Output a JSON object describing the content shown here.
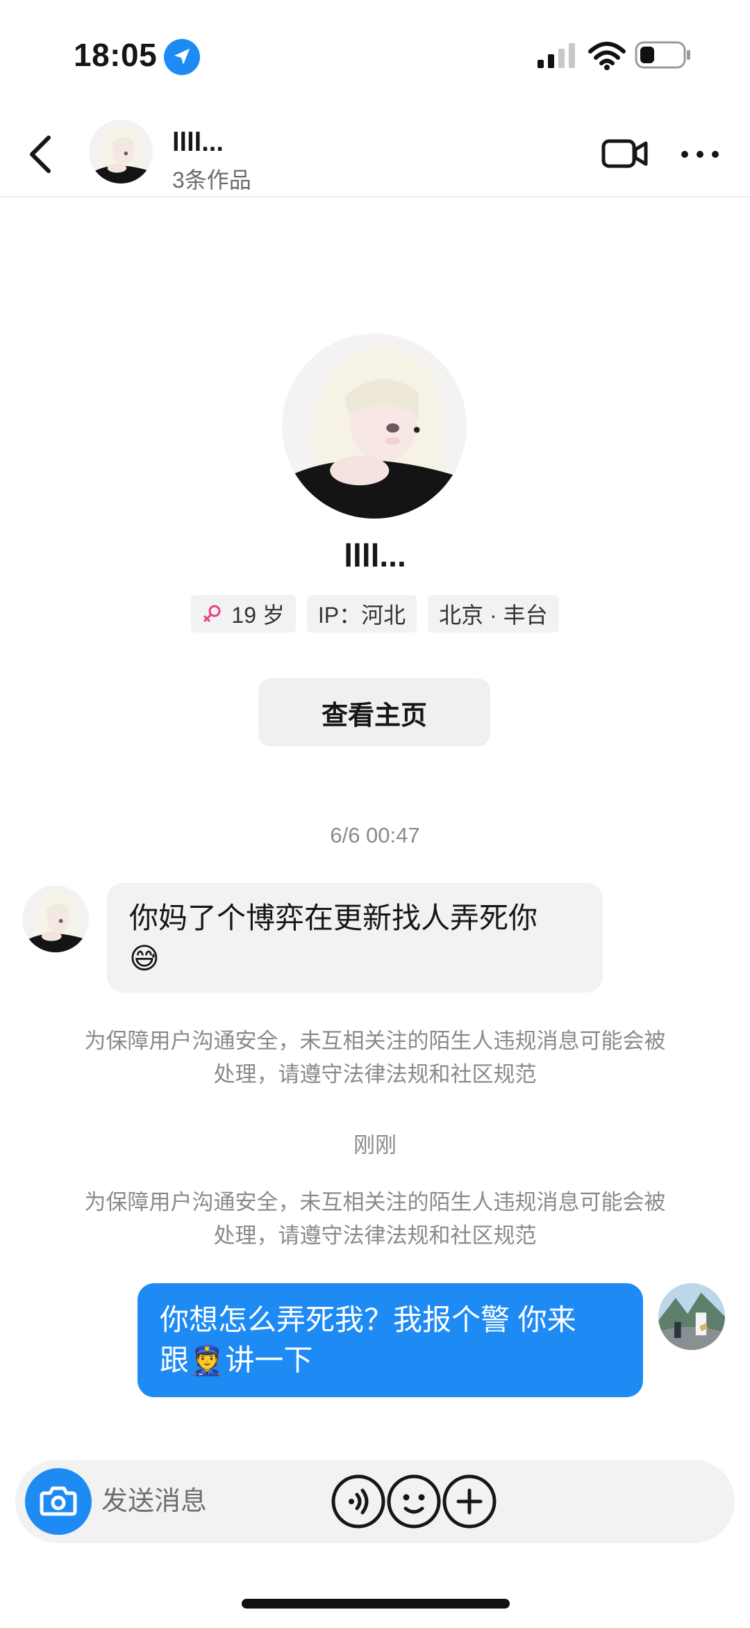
{
  "status_bar": {
    "time": "18:05"
  },
  "header": {
    "name": "llll...",
    "subtitle": "3条作品"
  },
  "profile": {
    "name": "llll...",
    "tags": [
      {
        "label": "19 岁",
        "icon": "female-icon"
      },
      {
        "label": "IP：河北"
      },
      {
        "label": "北京 · 丰台"
      }
    ],
    "view_button": "查看主页"
  },
  "conversation": {
    "timestamp_1": "6/6 00:47",
    "incoming_message": "你妈了个博弈在更新找人弄死你",
    "incoming_emoji": "😅",
    "notice_1": "为保障用户沟通安全，未互相关注的陌生人违规消息可能会被处理，请遵守法律法规和社区规范",
    "timestamp_2": "刚刚",
    "notice_2": "为保障用户沟通安全，未互相关注的陌生人违规消息可能会被处理，请遵守法律法规和社区规范",
    "outgoing_message_line1": "你想怎么弄死我？我报个警 你来",
    "outgoing_message_line2a": "跟",
    "outgoing_emoji": "👮",
    "outgoing_message_line2b": "讲一下"
  },
  "input_bar": {
    "placeholder": "发送消息",
    "icons": [
      "camera-icon",
      "voice-icon",
      "emoji-icon",
      "plus-icon"
    ]
  },
  "colors": {
    "accent": "#1e8bf5",
    "bubble_incoming": "#f2f2f2",
    "female_tag": "#e83e8c"
  }
}
